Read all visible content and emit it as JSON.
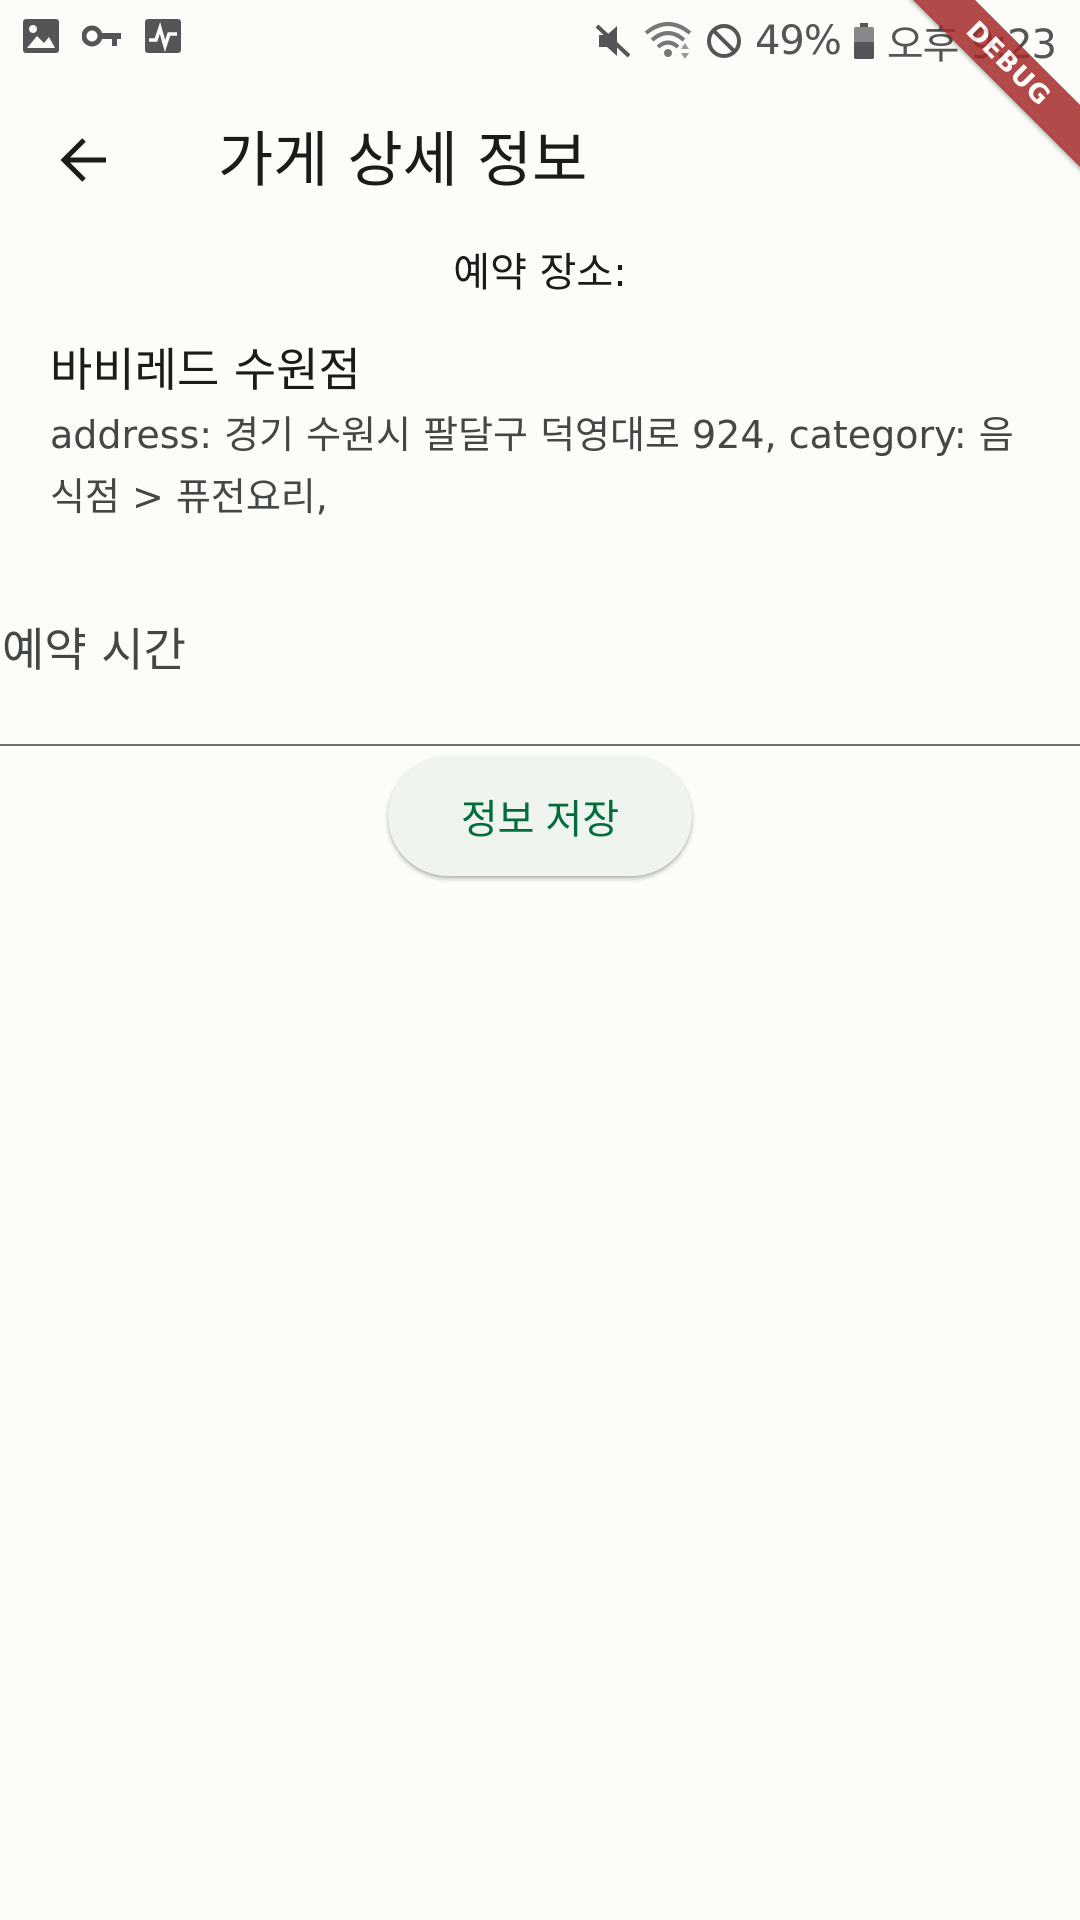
{
  "status_bar": {
    "left_icons": [
      "image-icon",
      "key-icon",
      "activity-icon"
    ],
    "right_icons": [
      "mute-icon",
      "wifi-icon",
      "block-icon",
      "battery-icon"
    ],
    "battery": "49%",
    "time": "오후 9:23"
  },
  "debug_banner": "DEBUG",
  "app_bar": {
    "back_icon": "arrow-back-icon",
    "title": "가게 상세 정보"
  },
  "reservation": {
    "place_label": "예약 장소:",
    "store_name": "바비레드 수원점",
    "store_detail": "address: 경기 수원시 팔달구 덕영대로 924, category: 음식점 > 퓨전요리,",
    "time_placeholder": "예약 시간",
    "save_label": "정보 저장"
  },
  "colors": {
    "background": "#fbfdf8",
    "accent": "#006d3b",
    "button_bg": "#eff4ee",
    "debug_banner": "#a52a2a"
  }
}
